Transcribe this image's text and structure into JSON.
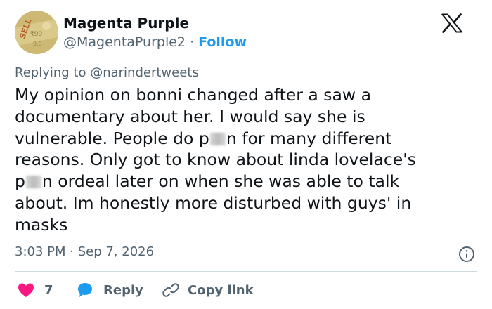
{
  "author": {
    "name": "Magenta Purple",
    "handle": "@MagentaPurple2",
    "separator": "·",
    "follow_label": "Follow"
  },
  "reply_context": {
    "prefix": "Replying to",
    "mention": "@narindertweets"
  },
  "tweet": {
    "lines": [
      "My opinion on bonni changed after a saw a",
      "documentary about her. I would say she is",
      "vulnerable. People do p",
      "n for many different",
      "reasons. Only got to know about linda lovelace's",
      "p",
      "n ordeal later on when she was able to talk",
      "about. Im honestly more disturbed with guys' in",
      "masks"
    ]
  },
  "timestamp": "3:03 PM · Sep 7, 2026",
  "actions": {
    "like_count": "7",
    "reply_label": "Reply",
    "copy_label": "Copy link"
  },
  "icons": {
    "logo": "x-logo-icon",
    "info": "info-icon",
    "like": "heart-icon",
    "reply": "speech-bubble-icon",
    "copy": "link-icon"
  },
  "colors": {
    "text": "#0f1419",
    "secondary": "#536471",
    "accent": "#1d9bf0",
    "like": "#f91880",
    "divider": "#cfd9de"
  }
}
